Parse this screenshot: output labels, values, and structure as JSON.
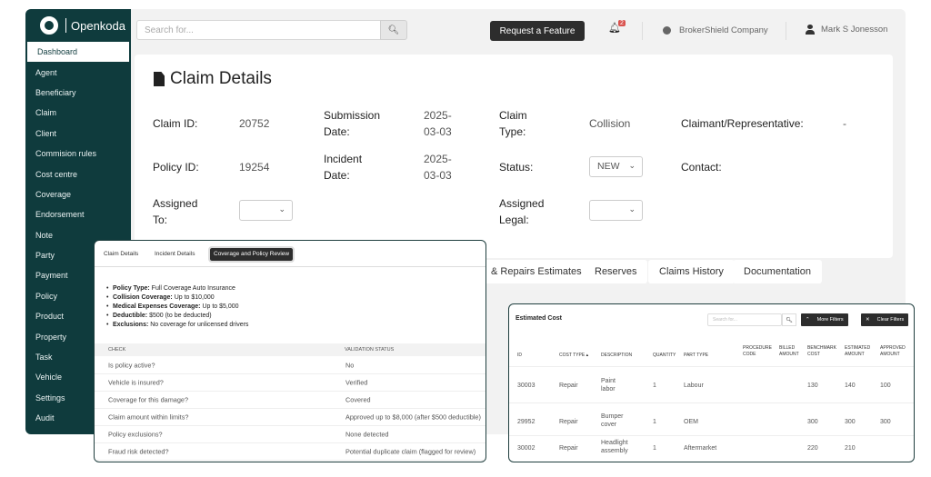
{
  "logo": {
    "text": "Openkoda"
  },
  "sidebar": {
    "items": [
      {
        "label": "Dashboard",
        "active": true
      },
      {
        "label": "Agent"
      },
      {
        "label": "Beneficiary"
      },
      {
        "label": "Claim"
      },
      {
        "label": "Client"
      },
      {
        "label": "Commision rules"
      },
      {
        "label": "Cost centre"
      },
      {
        "label": "Coverage"
      },
      {
        "label": "Endorsement"
      },
      {
        "label": "Note"
      },
      {
        "label": "Party"
      },
      {
        "label": "Payment"
      },
      {
        "label": "Policy"
      },
      {
        "label": "Product"
      },
      {
        "label": "Property"
      },
      {
        "label": "Task"
      },
      {
        "label": "Vehicle"
      },
      {
        "label": "Settings"
      },
      {
        "label": "Audit"
      }
    ]
  },
  "topbar": {
    "search_placeholder": "Search for...",
    "request_button": "Request a Feature",
    "notification_count": "2",
    "company": "BrokerShield Company",
    "user": "Mark S Jonesson"
  },
  "claim": {
    "title": "Claim Details",
    "claim_id_label": "Claim ID:",
    "claim_id": "20752",
    "submission_label_1": "Submission",
    "submission_label_2": "Date:",
    "submission_1": "2025-",
    "submission_2": "03-03",
    "type_label_1": "Claim",
    "type_label_2": "Type:",
    "type": "Collision",
    "claimant_label": "Claimant/Representative:",
    "claimant": "-",
    "policy_id_label": "Policy ID:",
    "policy_id": "19254",
    "incident_label_1": "Incident",
    "incident_label_2": "Date:",
    "incident_1": "2025-",
    "incident_2": "03-03",
    "status_label": "Status:",
    "status": "NEW",
    "contact_label": "Contact:",
    "assigned_label_1": "Assigned",
    "assigned_label_2": "To:",
    "legal_label_1": "Assigned",
    "legal_label_2": "Legal:"
  },
  "bottom_tabs": [
    {
      "label": "& Repairs Estimates"
    },
    {
      "label": "Reserves"
    },
    {
      "label": "Claims History"
    },
    {
      "label": "Documentation"
    }
  ],
  "review": {
    "tabs": [
      {
        "label": "Claim Details"
      },
      {
        "label": "Incident Details"
      },
      {
        "label": "Coverage and Policy Review",
        "active": true
      }
    ],
    "bullets": [
      {
        "key": "Policy Type:",
        "value": "Full Coverage Auto Insurance"
      },
      {
        "key": "Collision Coverage:",
        "value": "Up to $10,000"
      },
      {
        "key": "Medical Expenses Coverage:",
        "value": "Up to $5,000"
      },
      {
        "key": "Deductible:",
        "value": "$500 (to be deducted)"
      },
      {
        "key": "Exclusions:",
        "value": "No coverage for unlicensed drivers"
      }
    ],
    "headers": {
      "check": "CHECK",
      "status": "VALIDATION STATUS"
    },
    "rows": [
      {
        "check": "Is policy active?",
        "status": "No"
      },
      {
        "check": "Vehicle is insured?",
        "status": "Verified"
      },
      {
        "check": "Coverage for this damage?",
        "status": "Covered"
      },
      {
        "check": "Claim amount within limits?",
        "status": "Approved up to $8,000 (after $500 deductible)"
      },
      {
        "check": "Policy exclusions?",
        "status": "None detected"
      },
      {
        "check": "Fraud risk detected?",
        "status": "Potential duplicate claim (flagged for review)"
      }
    ]
  },
  "estimate": {
    "title": "Estimated Cost",
    "search_placeholder": "Search for...",
    "more_filters": "More Filters",
    "clear_filters": "Clear Filters",
    "headers": {
      "id": "ID",
      "cost_type": "COST TYPE",
      "description": "DESCRIPTION",
      "quantity": "QUANTITY",
      "part_type": "PART TYPE",
      "procedure_1": "PROCEDURE",
      "procedure_2": "CODE",
      "billed_1": "BILLED",
      "billed_2": "AMOUNT",
      "benchmark_1": "BENCHMARK",
      "benchmark_2": "COST",
      "estimated_1": "ESTIMATED",
      "estimated_2": "AMOUNT",
      "approved_1": "APPROVED",
      "approved_2": "AMOUNT"
    },
    "rows": [
      {
        "id": "30003",
        "cost_type": "Repair",
        "desc_1": "Paint",
        "desc_2": "labor",
        "quantity": "1",
        "part_type": "Labour",
        "benchmark": "130",
        "estimated": "140",
        "approved": "100"
      },
      {
        "id": "29952",
        "cost_type": "Repair",
        "desc_1": "Bumper",
        "desc_2": "cover",
        "quantity": "1",
        "part_type": "OEM",
        "benchmark": "300",
        "estimated": "300",
        "approved": "300"
      },
      {
        "id": "30002",
        "cost_type": "Repair",
        "desc_1": "Headlight",
        "desc_2": "assembly",
        "quantity": "1",
        "part_type": "Aftermarket",
        "benchmark": "220",
        "estimated": "210",
        "approved": ""
      }
    ]
  }
}
